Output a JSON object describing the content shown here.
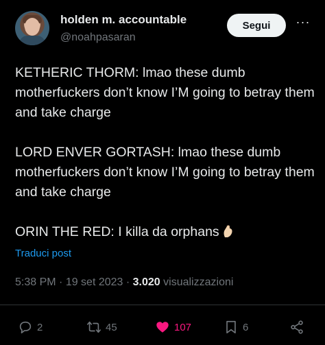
{
  "author": {
    "name": "holden m. accountable",
    "handle": "@noahpasaran"
  },
  "follow_label": "Segui",
  "more_label": "···",
  "tweet": {
    "paragraphs": [
      "KETHERIC THORM: lmao these dumb motherfuckers don’t know I’M going to betray them and take charge",
      "LORD ENVER GORTASH: lmao these dumb motherfuckers don’t know I’M going to betray them and take charge",
      "ORIN THE RED: I killa da orphans"
    ],
    "translate_label": "Traduci post"
  },
  "meta": {
    "time": "5:38 PM",
    "sep1": " · ",
    "date": "19 set 2023",
    "sep2": " · ",
    "views_count": "3.020",
    "views_label": " visualizzazioni"
  },
  "actions": {
    "replies": "2",
    "reposts": "45",
    "likes": "107",
    "bookmarks": "6"
  },
  "colors": {
    "background": "#000000",
    "text": "#e7e9ea",
    "muted": "#71767b",
    "link": "#1d9bf0",
    "like": "#f91880"
  },
  "icons": [
    "avatar",
    "more-icon",
    "pinched-fingers-emoji",
    "reply-icon",
    "repost-icon",
    "like-icon",
    "bookmark-icon",
    "share-icon"
  ]
}
